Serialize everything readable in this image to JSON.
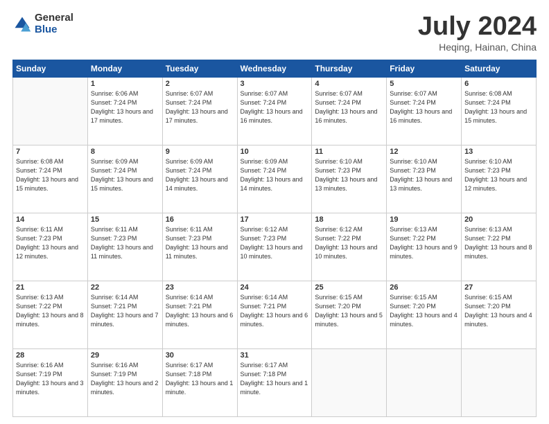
{
  "logo": {
    "general": "General",
    "blue": "Blue"
  },
  "title": "July 2024",
  "subtitle": "Heqing, Hainan, China",
  "days_of_week": [
    "Sunday",
    "Monday",
    "Tuesday",
    "Wednesday",
    "Thursday",
    "Friday",
    "Saturday"
  ],
  "weeks": [
    [
      {
        "day": "",
        "sunrise": "",
        "sunset": "",
        "daylight": "",
        "empty": true
      },
      {
        "day": "1",
        "sunrise": "Sunrise: 6:06 AM",
        "sunset": "Sunset: 7:24 PM",
        "daylight": "Daylight: 13 hours and 17 minutes."
      },
      {
        "day": "2",
        "sunrise": "Sunrise: 6:07 AM",
        "sunset": "Sunset: 7:24 PM",
        "daylight": "Daylight: 13 hours and 17 minutes."
      },
      {
        "day": "3",
        "sunrise": "Sunrise: 6:07 AM",
        "sunset": "Sunset: 7:24 PM",
        "daylight": "Daylight: 13 hours and 16 minutes."
      },
      {
        "day": "4",
        "sunrise": "Sunrise: 6:07 AM",
        "sunset": "Sunset: 7:24 PM",
        "daylight": "Daylight: 13 hours and 16 minutes."
      },
      {
        "day": "5",
        "sunrise": "Sunrise: 6:07 AM",
        "sunset": "Sunset: 7:24 PM",
        "daylight": "Daylight: 13 hours and 16 minutes."
      },
      {
        "day": "6",
        "sunrise": "Sunrise: 6:08 AM",
        "sunset": "Sunset: 7:24 PM",
        "daylight": "Daylight: 13 hours and 15 minutes."
      }
    ],
    [
      {
        "day": "7",
        "sunrise": "Sunrise: 6:08 AM",
        "sunset": "Sunset: 7:24 PM",
        "daylight": "Daylight: 13 hours and 15 minutes."
      },
      {
        "day": "8",
        "sunrise": "Sunrise: 6:09 AM",
        "sunset": "Sunset: 7:24 PM",
        "daylight": "Daylight: 13 hours and 15 minutes."
      },
      {
        "day": "9",
        "sunrise": "Sunrise: 6:09 AM",
        "sunset": "Sunset: 7:24 PM",
        "daylight": "Daylight: 13 hours and 14 minutes."
      },
      {
        "day": "10",
        "sunrise": "Sunrise: 6:09 AM",
        "sunset": "Sunset: 7:24 PM",
        "daylight": "Daylight: 13 hours and 14 minutes."
      },
      {
        "day": "11",
        "sunrise": "Sunrise: 6:10 AM",
        "sunset": "Sunset: 7:23 PM",
        "daylight": "Daylight: 13 hours and 13 minutes."
      },
      {
        "day": "12",
        "sunrise": "Sunrise: 6:10 AM",
        "sunset": "Sunset: 7:23 PM",
        "daylight": "Daylight: 13 hours and 13 minutes."
      },
      {
        "day": "13",
        "sunrise": "Sunrise: 6:10 AM",
        "sunset": "Sunset: 7:23 PM",
        "daylight": "Daylight: 13 hours and 12 minutes."
      }
    ],
    [
      {
        "day": "14",
        "sunrise": "Sunrise: 6:11 AM",
        "sunset": "Sunset: 7:23 PM",
        "daylight": "Daylight: 13 hours and 12 minutes."
      },
      {
        "day": "15",
        "sunrise": "Sunrise: 6:11 AM",
        "sunset": "Sunset: 7:23 PM",
        "daylight": "Daylight: 13 hours and 11 minutes."
      },
      {
        "day": "16",
        "sunrise": "Sunrise: 6:11 AM",
        "sunset": "Sunset: 7:23 PM",
        "daylight": "Daylight: 13 hours and 11 minutes."
      },
      {
        "day": "17",
        "sunrise": "Sunrise: 6:12 AM",
        "sunset": "Sunset: 7:23 PM",
        "daylight": "Daylight: 13 hours and 10 minutes."
      },
      {
        "day": "18",
        "sunrise": "Sunrise: 6:12 AM",
        "sunset": "Sunset: 7:22 PM",
        "daylight": "Daylight: 13 hours and 10 minutes."
      },
      {
        "day": "19",
        "sunrise": "Sunrise: 6:13 AM",
        "sunset": "Sunset: 7:22 PM",
        "daylight": "Daylight: 13 hours and 9 minutes."
      },
      {
        "day": "20",
        "sunrise": "Sunrise: 6:13 AM",
        "sunset": "Sunset: 7:22 PM",
        "daylight": "Daylight: 13 hours and 8 minutes."
      }
    ],
    [
      {
        "day": "21",
        "sunrise": "Sunrise: 6:13 AM",
        "sunset": "Sunset: 7:22 PM",
        "daylight": "Daylight: 13 hours and 8 minutes."
      },
      {
        "day": "22",
        "sunrise": "Sunrise: 6:14 AM",
        "sunset": "Sunset: 7:21 PM",
        "daylight": "Daylight: 13 hours and 7 minutes."
      },
      {
        "day": "23",
        "sunrise": "Sunrise: 6:14 AM",
        "sunset": "Sunset: 7:21 PM",
        "daylight": "Daylight: 13 hours and 6 minutes."
      },
      {
        "day": "24",
        "sunrise": "Sunrise: 6:14 AM",
        "sunset": "Sunset: 7:21 PM",
        "daylight": "Daylight: 13 hours and 6 minutes."
      },
      {
        "day": "25",
        "sunrise": "Sunrise: 6:15 AM",
        "sunset": "Sunset: 7:20 PM",
        "daylight": "Daylight: 13 hours and 5 minutes."
      },
      {
        "day": "26",
        "sunrise": "Sunrise: 6:15 AM",
        "sunset": "Sunset: 7:20 PM",
        "daylight": "Daylight: 13 hours and 4 minutes."
      },
      {
        "day": "27",
        "sunrise": "Sunrise: 6:15 AM",
        "sunset": "Sunset: 7:20 PM",
        "daylight": "Daylight: 13 hours and 4 minutes."
      }
    ],
    [
      {
        "day": "28",
        "sunrise": "Sunrise: 6:16 AM",
        "sunset": "Sunset: 7:19 PM",
        "daylight": "Daylight: 13 hours and 3 minutes."
      },
      {
        "day": "29",
        "sunrise": "Sunrise: 6:16 AM",
        "sunset": "Sunset: 7:19 PM",
        "daylight": "Daylight: 13 hours and 2 minutes."
      },
      {
        "day": "30",
        "sunrise": "Sunrise: 6:17 AM",
        "sunset": "Sunset: 7:18 PM",
        "daylight": "Daylight: 13 hours and 1 minute."
      },
      {
        "day": "31",
        "sunrise": "Sunrise: 6:17 AM",
        "sunset": "Sunset: 7:18 PM",
        "daylight": "Daylight: 13 hours and 1 minute."
      },
      {
        "day": "",
        "sunrise": "",
        "sunset": "",
        "daylight": "",
        "empty": true
      },
      {
        "day": "",
        "sunrise": "",
        "sunset": "",
        "daylight": "",
        "empty": true
      },
      {
        "day": "",
        "sunrise": "",
        "sunset": "",
        "daylight": "",
        "empty": true
      }
    ]
  ]
}
